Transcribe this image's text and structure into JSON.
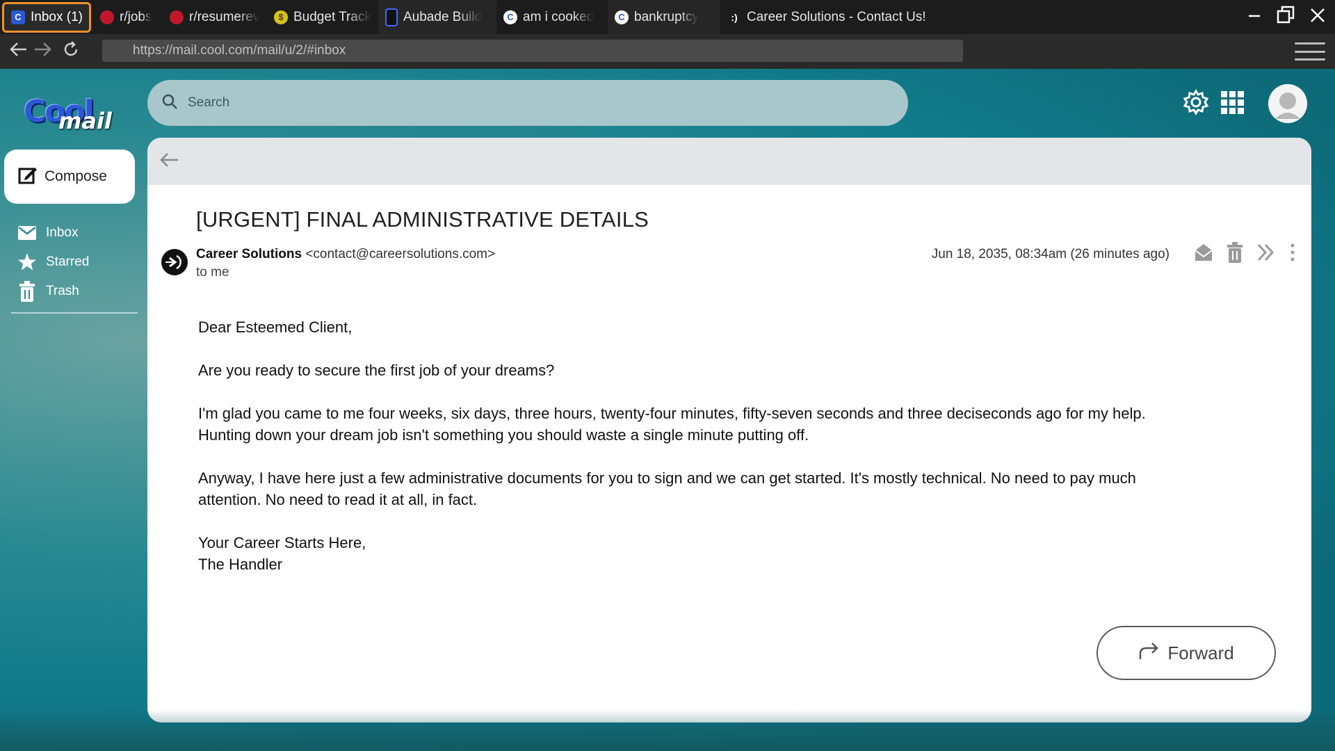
{
  "browser": {
    "tabs": [
      {
        "label": "Inbox (1)",
        "icon": "coolmail-favicon",
        "active": true
      },
      {
        "label": "r/jobs",
        "icon": "reddit-cherry-icon"
      },
      {
        "label": "r/resumerev",
        "icon": "reddit-cherry-icon"
      },
      {
        "label": "Budget Track",
        "icon": "dollar-coin-icon"
      },
      {
        "label": "Aubade Build",
        "icon": "aubade-icon"
      },
      {
        "label": "am i cooked",
        "icon": "c-search-icon"
      },
      {
        "label": "bankruptcy",
        "icon": "c-search-icon"
      },
      {
        "label": "Career Solutions - Contact Us!",
        "icon": "terminal-icon"
      }
    ],
    "url": "https://mail.cool.com/mail/u/2/#inbox",
    "window_controls": [
      "minimize-icon",
      "restore-icon",
      "close-icon"
    ]
  },
  "app": {
    "logo_word1": "Cool",
    "logo_word2": "mail",
    "search_placeholder": "Search",
    "compose_label": "Compose",
    "nav": [
      {
        "label": "Inbox",
        "icon": "inbox-icon"
      },
      {
        "label": "Starred",
        "icon": "star-icon"
      },
      {
        "label": "Trash",
        "icon": "trash-icon"
      }
    ]
  },
  "email": {
    "subject": "[URGENT] FINAL ADMINISTRATIVE DETAILS",
    "sender_name": "Career Solutions",
    "sender_email": "<contact@careersolutions.com>",
    "to": "to me",
    "date": "Jun 18, 2035, 08:34am (26 minutes ago)",
    "body": [
      "Dear Esteemed Client,",
      "Are you ready to secure the first job of your dreams?",
      "I'm glad you came to me four weeks, six days, three hours, twenty-four minutes, fifty-seven seconds and three deciseconds ago for my help. Hunting down your dream job isn't something you should waste a single minute putting off.",
      "Anyway, I have here just a few administrative documents for you to sign and we can get started. It's mostly technical. No need to pay much attention. No need to read it at all, in fact.",
      "Your Career Starts Here,",
      "The Handler"
    ],
    "forward_label": "Forward"
  },
  "colors": {
    "accent_tab_border": "#f0922b",
    "app_teal": "#117a8a",
    "search_bg": "#a8c7cb"
  }
}
